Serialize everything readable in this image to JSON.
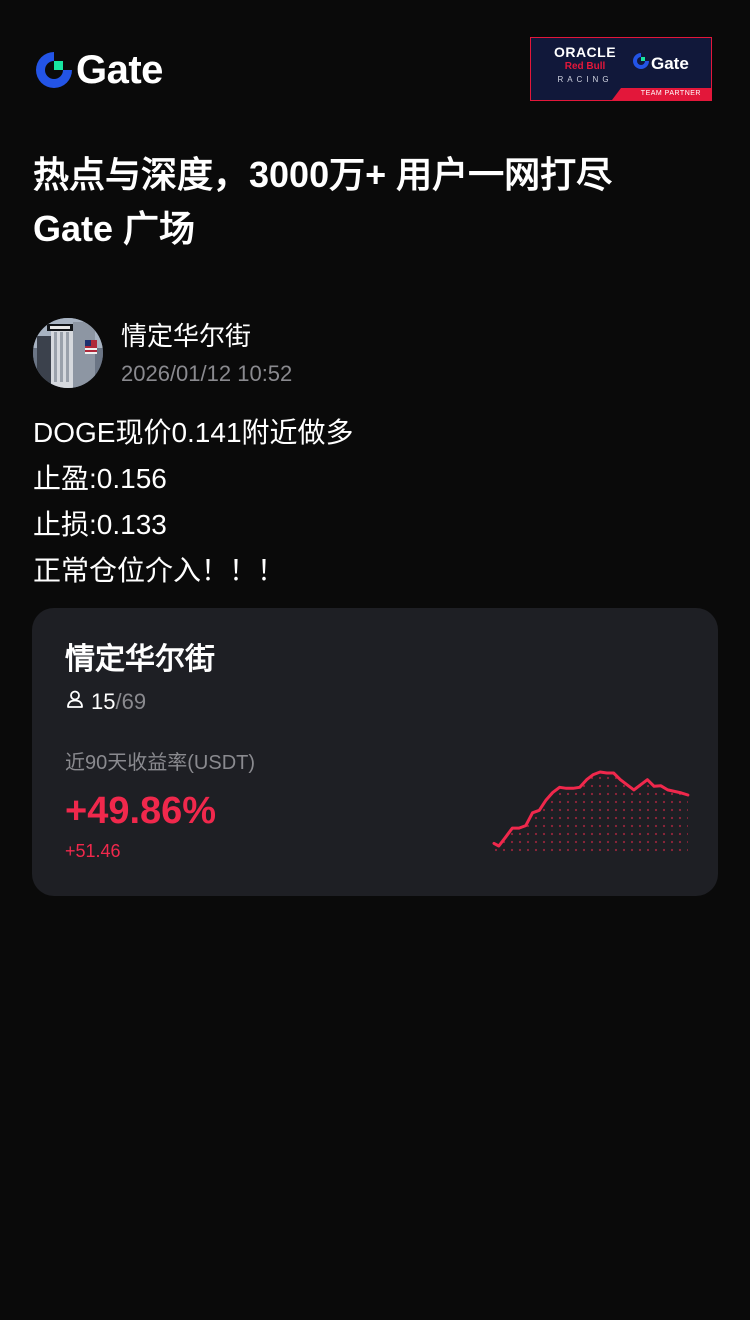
{
  "header": {
    "brand": "Gate",
    "partner": {
      "oracle": "ORACLE",
      "redbull": "Red Bull",
      "racing": "RACING",
      "gate": "Gate",
      "tag": "TEAM PARTNER"
    }
  },
  "headline": {
    "line1": "热点与深度，3000万+ 用户一网打尽",
    "line2": "Gate 广场"
  },
  "author": {
    "name": "情定华尔街",
    "time": "2026/01/12 10:52"
  },
  "post": {
    "lines": [
      "DOGE现价0.141附近做多",
      "止盈:0.156",
      "止损:0.133",
      "正常仓位介入！！！"
    ]
  },
  "card": {
    "title": "情定华尔街",
    "members_current": "15",
    "members_sep": "/",
    "members_max": "69",
    "metric_label": "近90天收益率(USDT)",
    "roi": "+49.86%",
    "pnl": "+51.46"
  },
  "colors": {
    "background": "#0a0a0a",
    "card": "#1e1f24",
    "positive": "#f0284c",
    "muted": "#8a8a8f",
    "brand_blue": "#2354e6",
    "brand_green": "#17e6a1"
  },
  "icons": {
    "member": "person-icon",
    "logo": "gate-logo-icon"
  },
  "chart_data": {
    "type": "area",
    "title": "",
    "xlabel": "",
    "ylabel": "",
    "series": [
      {
        "values": [
          0.0,
          -0.5,
          1.2,
          3.0,
          3.0,
          3.5,
          6.0,
          6.5,
          8.5,
          10.0,
          11.0,
          10.8,
          10.8,
          11.0,
          12.5,
          13.5,
          14.0,
          13.8,
          13.8,
          12.5,
          11.5,
          10.5,
          11.5,
          12.5,
          11.2,
          11.3,
          10.5,
          10.2,
          9.9,
          9.5
        ]
      }
    ]
  }
}
